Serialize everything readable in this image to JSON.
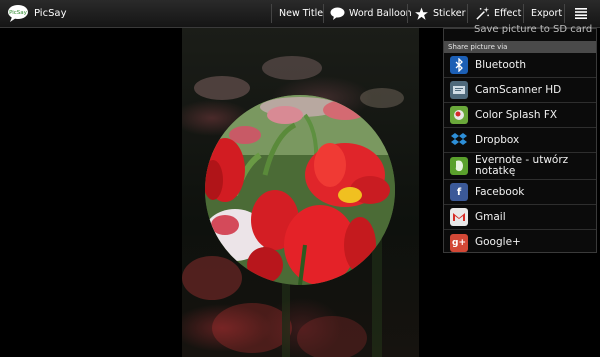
{
  "app": {
    "title": "PicSay",
    "logo_text": "PicSay"
  },
  "toolbar": {
    "new_title": "New Title",
    "word_balloon": "Word Balloon",
    "sticker": "Sticker",
    "effect": "Effect",
    "export": "Export"
  },
  "menu": {
    "partial_item": "Save picture to SD card",
    "section_header": "Share picture via",
    "items": [
      {
        "label": "Bluetooth",
        "icon": "bluetooth-icon",
        "color": "#1c5fb5"
      },
      {
        "label": "CamScanner HD",
        "icon": "camscanner-icon",
        "color": "#4f6a7c"
      },
      {
        "label": "Color Splash FX",
        "icon": "color-splash-icon",
        "color": "#6aa83a"
      },
      {
        "label": "Dropbox",
        "icon": "dropbox-icon",
        "color": "#2d8fd8"
      },
      {
        "label": "Evernote - utwórz notatkę",
        "icon": "evernote-icon",
        "color": "#5aa02c"
      },
      {
        "label": "Facebook",
        "icon": "facebook-icon",
        "color": "#3b5998"
      },
      {
        "label": "Gmail",
        "icon": "gmail-icon",
        "color": "#d8d8d8"
      },
      {
        "label": "Google+",
        "icon": "google-plus-icon",
        "color": "#d34836"
      }
    ]
  }
}
